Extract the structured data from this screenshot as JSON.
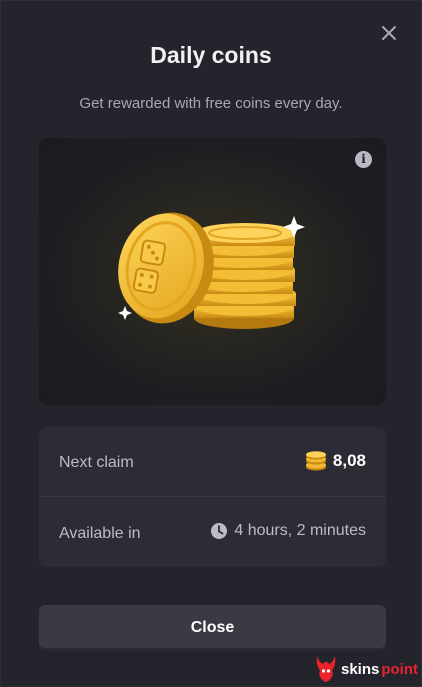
{
  "modal": {
    "title": "Daily coins",
    "subtitle": "Get rewarded with free coins every day.",
    "close_icon": "close-icon",
    "info_icon": "info-icon"
  },
  "rows": [
    {
      "label": "Next claim",
      "value": "8,08",
      "icon": "coin-stack-icon"
    },
    {
      "label": "Available in",
      "value": "4 hours, 2 minutes",
      "icon": "clock-icon"
    }
  ],
  "close_button": {
    "label": "Close"
  },
  "brand": {
    "part1": "skins",
    "part2": "point",
    "accent": "#e8232b"
  },
  "colors": {
    "background": "#24242c",
    "panel": "#2c2c35",
    "coin_gold": "#f2b733"
  }
}
